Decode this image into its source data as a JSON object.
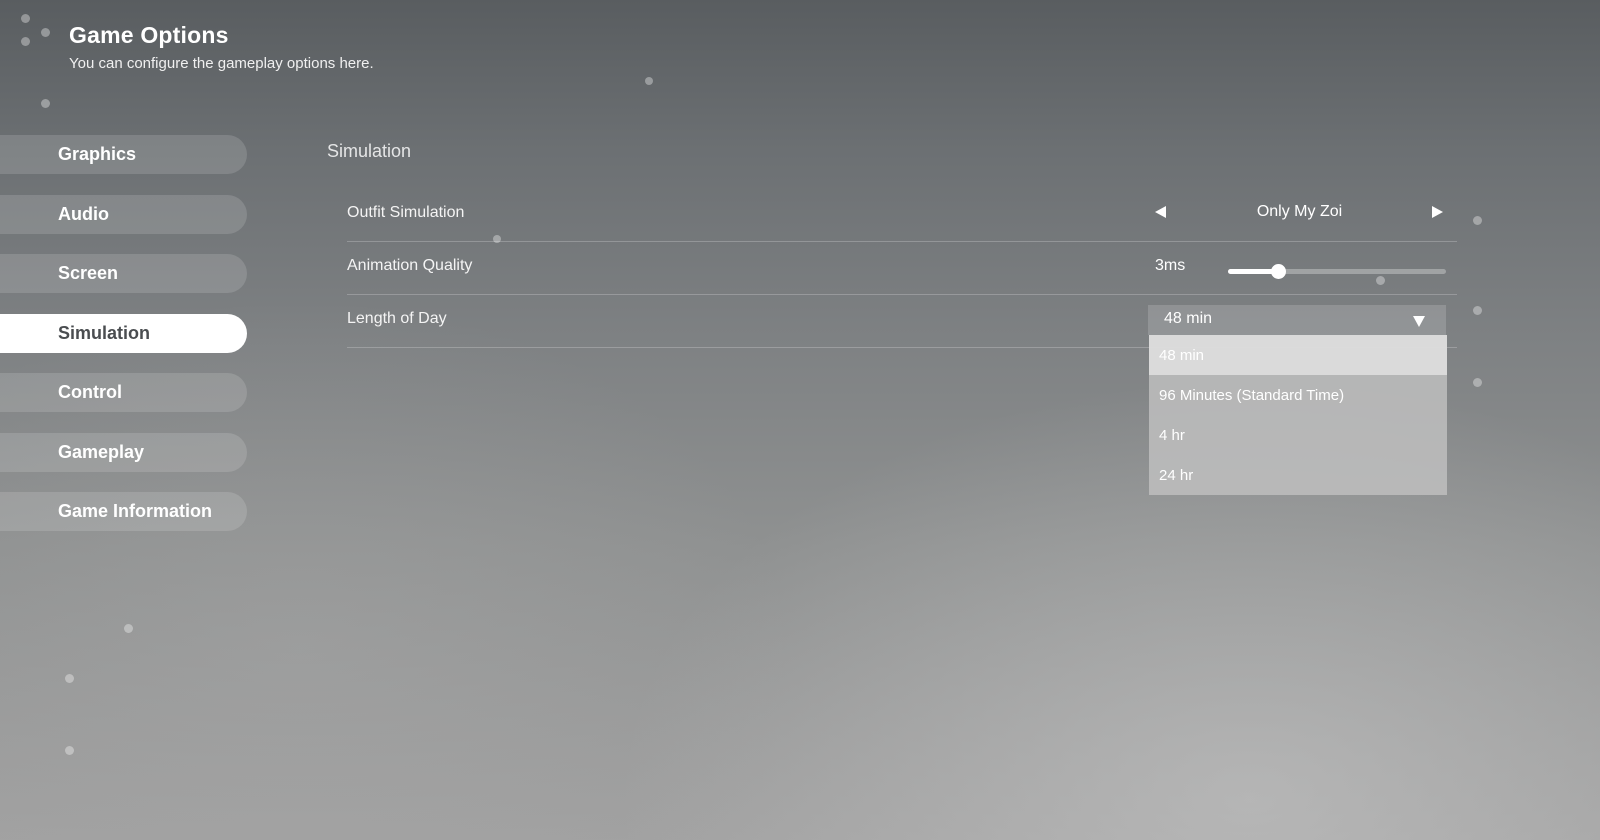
{
  "header": {
    "title": "Game Options",
    "subtitle": "You can configure the gameplay options here."
  },
  "sidebar": {
    "items": [
      {
        "label": "Graphics",
        "active": false
      },
      {
        "label": "Audio",
        "active": false
      },
      {
        "label": "Screen",
        "active": false
      },
      {
        "label": "Simulation",
        "active": true
      },
      {
        "label": "Control",
        "active": false
      },
      {
        "label": "Gameplay",
        "active": false
      },
      {
        "label": "Game Information",
        "active": false
      }
    ]
  },
  "main": {
    "section_title": "Simulation",
    "settings": {
      "outfit_simulation": {
        "label": "Outfit Simulation",
        "value": "Only My Zoi",
        "prev_icon": "triangle-left-icon",
        "next_icon": "triangle-right-icon"
      },
      "animation_quality": {
        "label": "Animation Quality",
        "value_text": "3ms",
        "slider_level": 0.23
      },
      "length_of_day": {
        "label": "Length of Day",
        "value": "48 min",
        "arrow_icon": "triangle-down-icon",
        "options": [
          "48 min",
          "96 Minutes (Standard Time)",
          "4 hr",
          "24 hr"
        ],
        "selected_index": 0
      }
    }
  },
  "colors": {
    "active_tab_bg": "#ffffff",
    "active_tab_text": "#4a4d50",
    "text": "#ffffff"
  }
}
